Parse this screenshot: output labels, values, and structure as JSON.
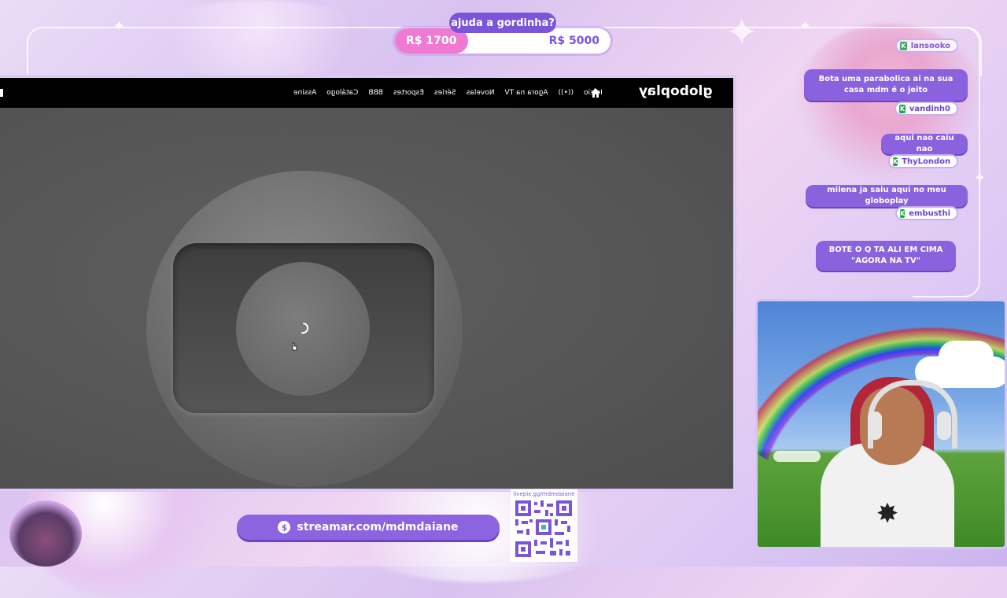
{
  "goal": {
    "title": "ajuda a gordinha?",
    "current": "R$ 1700",
    "target": "R$ 5000",
    "progress": 0.34
  },
  "globoplay": {
    "logo": "globoplay",
    "nav": [
      "Início",
      "Agora na TV",
      "Novelas",
      "Séries",
      "Esportes",
      "BBB",
      "Catálogo",
      "Assine"
    ]
  },
  "chat": [
    {
      "user": "lansooko"
    },
    {
      "message": "Bota uma parabolica ai na sua casa mdm é o jeito",
      "user": "vandinh0"
    },
    {
      "message": "aqui nao caiu nao",
      "user": "ThyLondon"
    },
    {
      "message": "milena ja saiu aqui no meu globoplay",
      "user": "embusthi"
    },
    {
      "message": "BOTE O Q TA ALI EM CIMA \"AGORA NA TV\""
    }
  ],
  "footer": {
    "url": "streamar.com/mdmdaiane",
    "qr_label": "livepix.gg/mdmdaiane"
  },
  "icons": {
    "home": "home-icon",
    "live": "live-signal-icon",
    "spinner": "loading-spinner-icon",
    "kick": "kick-badge-icon",
    "currency": "coin-icon"
  },
  "colors": {
    "accent": "#8a62dd",
    "goal_fill": "#f07ad1",
    "kick_green": "#1aa64a"
  }
}
